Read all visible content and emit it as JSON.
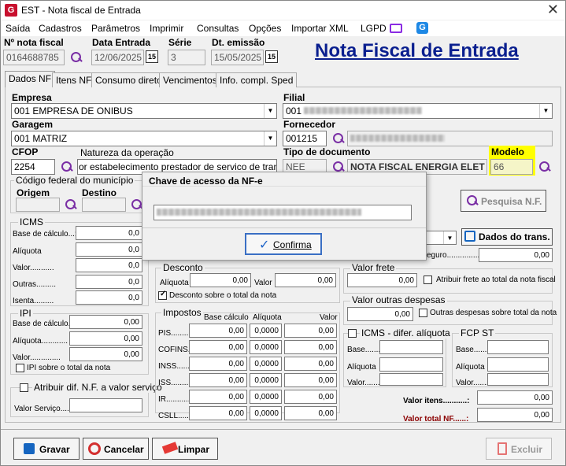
{
  "window": {
    "title": "EST - Nota fiscal de Entrada",
    "close": "✕",
    "app_icon": "G"
  },
  "menu": [
    "Saída",
    "Cadastros",
    "Parâmetros",
    "Imprimir",
    "Consultas",
    "Opções",
    "Importar XML",
    "LGPD"
  ],
  "header": {
    "nota_label": "Nº nota fiscal",
    "nota_value": "0164688785",
    "data_entrada_label": "Data Entrada",
    "data_entrada_value": "12/06/2025",
    "serie_label": "Série",
    "serie_value": "3",
    "dt_emissao_label": "Dt. emissão",
    "dt_emissao_value": "15/05/2025",
    "cal_glyph": "15",
    "page_title": "Nota Fiscal de Entrada"
  },
  "tabs": [
    "Dados NF",
    "Itens NF",
    "Consumo direto",
    "Vencimentos",
    "Info. compl. Sped"
  ],
  "form": {
    "empresa_label": "Empresa",
    "empresa_value": "001 EMPRESA DE ONIBUS",
    "filial_label": "Filial",
    "filial_value": "001",
    "garagem_label": "Garagem",
    "garagem_value": "001 MATRIZ",
    "fornecedor_label": "Fornecedor",
    "fornecedor_value": "001215",
    "cfop_label": "CFOP",
    "cfop_value": "2254",
    "natureza_label": "Natureza da operação",
    "natureza_value": "or estabelecimento prestador de servico de transporte",
    "tipo_doc_label": "Tipo de documento",
    "tipo_doc_code": "NEE",
    "tipo_doc_desc": "NOTA FISCAL ENERGIA ELET",
    "modelo_label": "Modelo",
    "modelo_value": "66",
    "municipio_label": "Código federal do município",
    "origem_label": "Origem",
    "destino_label": "Destino",
    "pesquisa_label": "Pesquisa N.F.",
    "dados_trans_label": "Dados do trans."
  },
  "icms": {
    "title": "ICMS",
    "rows": [
      "Base de cálculo...:",
      "Alíquota",
      "Valor...........",
      "Outras.........",
      "Isenta........."
    ],
    "values": [
      "0,0",
      "0,0",
      "0,0",
      "0,0",
      "0,0"
    ]
  },
  "ipi": {
    "title": "IPI",
    "rows": [
      "Base de cálculo..:",
      "Alíquota............",
      "Valor.............."
    ],
    "values": [
      "0,00",
      "0,00",
      "0,00"
    ],
    "check": "IPI sobre o total da nota"
  },
  "atribuir": {
    "label": "Atribuir dif. N.F. a valor serviço",
    "valor_servico": "Valor Serviço......"
  },
  "desconto": {
    "title": "Desconto",
    "aliquota": "Alíquota",
    "aliq_value": "0,00",
    "valor": "Valor",
    "valor_value": "0,00",
    "check": "Desconto sobre o total da nota"
  },
  "impostos": {
    "title": "Impostos",
    "col_base": "Base cálculo",
    "col_aliq": "Alíquota",
    "col_valor": "Valor",
    "rows": [
      {
        "name": "PIS.........",
        "base": "0,00",
        "aliq": "0,0000",
        "valor": "0,00"
      },
      {
        "name": "COFINS.",
        "base": "0,00",
        "aliq": "0,0000",
        "valor": "0,00"
      },
      {
        "name": "INSS........",
        "base": "0,00",
        "aliq": "0,0000",
        "valor": "0,00"
      },
      {
        "name": "ISS..........",
        "base": "0,00",
        "aliq": "0,0000",
        "valor": "0,00"
      },
      {
        "name": "IR............",
        "base": "0,00",
        "aliq": "0,0000",
        "valor": "0,00"
      },
      {
        "name": "CSLL......",
        "base": "0,00",
        "aliq": "0,0000",
        "valor": "0,00"
      }
    ]
  },
  "right": {
    "seguro_label": "eguro......................",
    "seguro_value": "0,00",
    "frete_title": "Valor frete",
    "frete_value": "0,00",
    "frete_check": "Atribuir frete ao total da nota fiscal",
    "outras_title": "Valor outras despesas",
    "outras_value": "0,00",
    "outras_check": "Outras despesas sobre total da nota",
    "icms_dif_title": "ICMS - difer. alíquota",
    "base": "Base.........",
    "aliquota": "Alíquota",
    "valor": "Valor.........",
    "fcp_title": "FCP ST",
    "fcp_base": "Base.........",
    "fcp_aliquota": "Alíquota",
    "fcp_valor": "Valor.........",
    "valor_itens_label": "Valor itens...........:",
    "valor_itens_value": "0,00",
    "valor_total_label": "Valor total NF......:",
    "valor_total_value": "0,00"
  },
  "dialog": {
    "title": "Chave de acesso da NF-e",
    "confirm": "Confirma"
  },
  "buttons": {
    "gravar": "Gravar",
    "cancelar": "Cancelar",
    "limpar": "Limpar",
    "excluir": "Excluir"
  },
  "colors": {
    "title_blue": "#0a1f8f",
    "highlight": "#ffff00",
    "total_red": "#8b0000",
    "icon_purple": "#7a2fa5"
  }
}
